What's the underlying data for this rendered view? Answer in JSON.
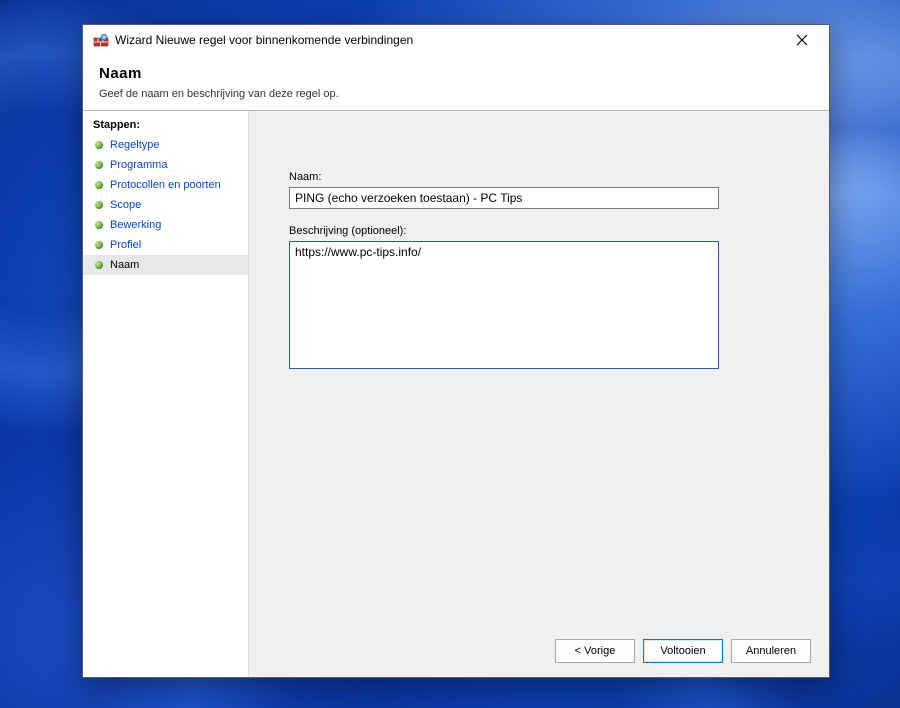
{
  "window": {
    "title": "Wizard Nieuwe regel voor binnenkomende verbindingen"
  },
  "header": {
    "title": "Naam",
    "subtitle": "Geef de naam en beschrijving van deze regel op."
  },
  "sidebar": {
    "heading": "Stappen:",
    "steps": [
      {
        "label": "Regeltype",
        "current": false
      },
      {
        "label": "Programma",
        "current": false
      },
      {
        "label": "Protocollen en poorten",
        "current": false
      },
      {
        "label": "Scope",
        "current": false
      },
      {
        "label": "Bewerking",
        "current": false
      },
      {
        "label": "Profiel",
        "current": false
      },
      {
        "label": "Naam",
        "current": true
      }
    ]
  },
  "form": {
    "name_label": "Naam:",
    "name_value": "PING (echo verzoeken toestaan) - PC Tips",
    "description_label": "Beschrijving (optioneel):",
    "description_value": "https://www.pc-tips.info/"
  },
  "buttons": {
    "back": "< Vorige",
    "finish": "Voltooien",
    "cancel": "Annuleren"
  }
}
